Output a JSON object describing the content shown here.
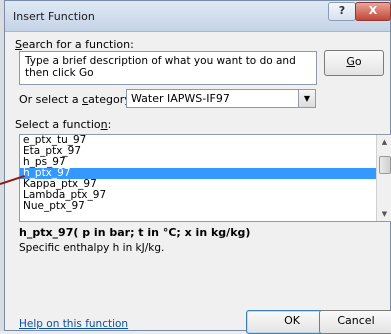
{
  "dialog": {
    "title": "Insert Function",
    "help_glyph": "?",
    "close_glyph": "X"
  },
  "search": {
    "label_pre": "",
    "label_hot": "S",
    "label_post": "earch for a function:",
    "text": "Type a brief description of what you want to do and then click Go",
    "go_pre": "",
    "go_hot": "G",
    "go_post": "o"
  },
  "category": {
    "label_pre": "Or select a ",
    "label_hot": "c",
    "label_post": "ategory:",
    "value": "Water IAPWS-IF97",
    "drop_icon": "▼"
  },
  "functions": {
    "label_pre": "Select a functio",
    "label_hot": "n",
    "label_post": ":",
    "items": [
      "e_ptx_tu_97",
      "Eta_ptx_97",
      "h_ps_97",
      "h_ptx_97",
      "Kappa_ptx_97",
      "Lambda_ptx_97",
      "Nue_ptx_97"
    ],
    "selected_index": 3,
    "scroll_up_icon": "▲",
    "scroll_down_icon": "▼"
  },
  "details": {
    "signature": "h_ptx_97( p in bar; t in °C; x in kg/kg)",
    "description": "Specific enthalpy h in kJ/kg."
  },
  "footer": {
    "help_link": "Help on this function",
    "ok_label": "OK",
    "cancel_label": "Cancel"
  }
}
